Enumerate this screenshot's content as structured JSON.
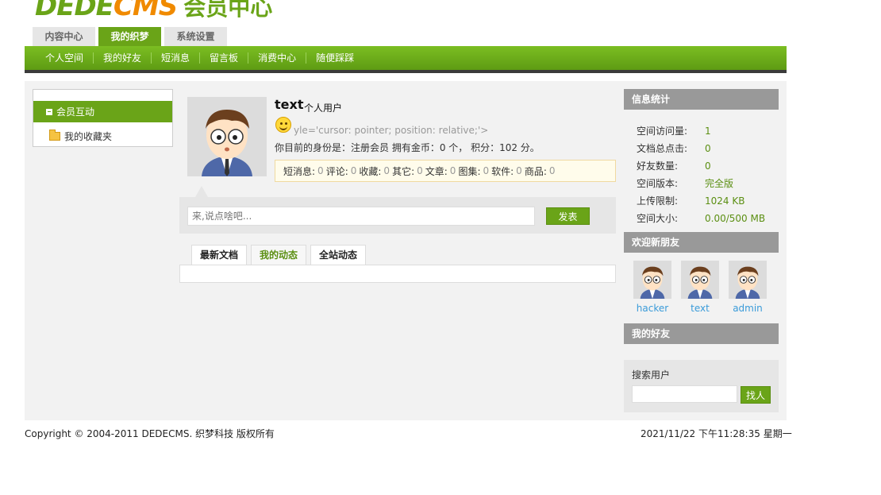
{
  "logo": {
    "part1": "DEDE",
    "part2": "CMS",
    "part3": "会员中心"
  },
  "top_tabs": [
    {
      "label": "内容中心"
    },
    {
      "label": "我的织梦"
    },
    {
      "label": "系统设置"
    }
  ],
  "nav": [
    {
      "label": "个人空间"
    },
    {
      "label": "我的好友"
    },
    {
      "label": "短消息"
    },
    {
      "label": "留言板"
    },
    {
      "label": "消费中心"
    },
    {
      "label": "随便踩踩"
    }
  ],
  "sidebar": {
    "section_title": "会员互动",
    "items": [
      {
        "label": "我的收藏夹"
      }
    ]
  },
  "profile": {
    "name": "text",
    "type": "个人用户",
    "broken_text": "yle='cursor: pointer; position: relative;'>",
    "identity_line": "你目前的身份是：注册会员 拥有金币：0 个， 积分：102 分。",
    "stats": [
      {
        "label": "短消息:",
        "value": "0"
      },
      {
        "label": "评论:",
        "value": "0"
      },
      {
        "label": "收藏:",
        "value": "0"
      },
      {
        "label": "其它:",
        "value": "0"
      },
      {
        "label": "文章:",
        "value": "0"
      },
      {
        "label": "图集:",
        "value": "0"
      },
      {
        "label": "软件:",
        "value": "0"
      },
      {
        "label": "商品:",
        "value": "0"
      }
    ]
  },
  "post": {
    "placeholder": "来,说点啥吧...",
    "button": "发表"
  },
  "feed_tabs": [
    {
      "label": "最新文档"
    },
    {
      "label": "我的动态"
    },
    {
      "label": "全站动态"
    }
  ],
  "info": {
    "title": "信息统计",
    "rows": [
      {
        "label": "空间访问量:",
        "value": "1"
      },
      {
        "label": "文档总点击:",
        "value": "0"
      },
      {
        "label": "好友数量:",
        "value": "0"
      },
      {
        "label": "空间版本:",
        "value": "完全版"
      },
      {
        "label": "上传限制:",
        "value": "1024 KB"
      },
      {
        "label": "空间大小:",
        "value": "0.00/500 MB"
      }
    ]
  },
  "new_friends": {
    "title": "欢迎新朋友",
    "users": [
      {
        "name": "hacker"
      },
      {
        "name": "text"
      },
      {
        "name": "admin"
      }
    ]
  },
  "my_friends": {
    "title": "我的好友"
  },
  "search": {
    "label": "搜索用户",
    "button": "找人"
  },
  "footer": {
    "copyright": "Copyright © 2004-2011 DEDECMS. 织梦科技 版权所有",
    "datetime": "2021/11/22 下午11:28:35 星期一"
  },
  "colors": {
    "brand_green": "#6aa418",
    "brand_orange": "#f08a00",
    "link_blue": "#3a9bd9",
    "panel_gray": "#999999"
  }
}
